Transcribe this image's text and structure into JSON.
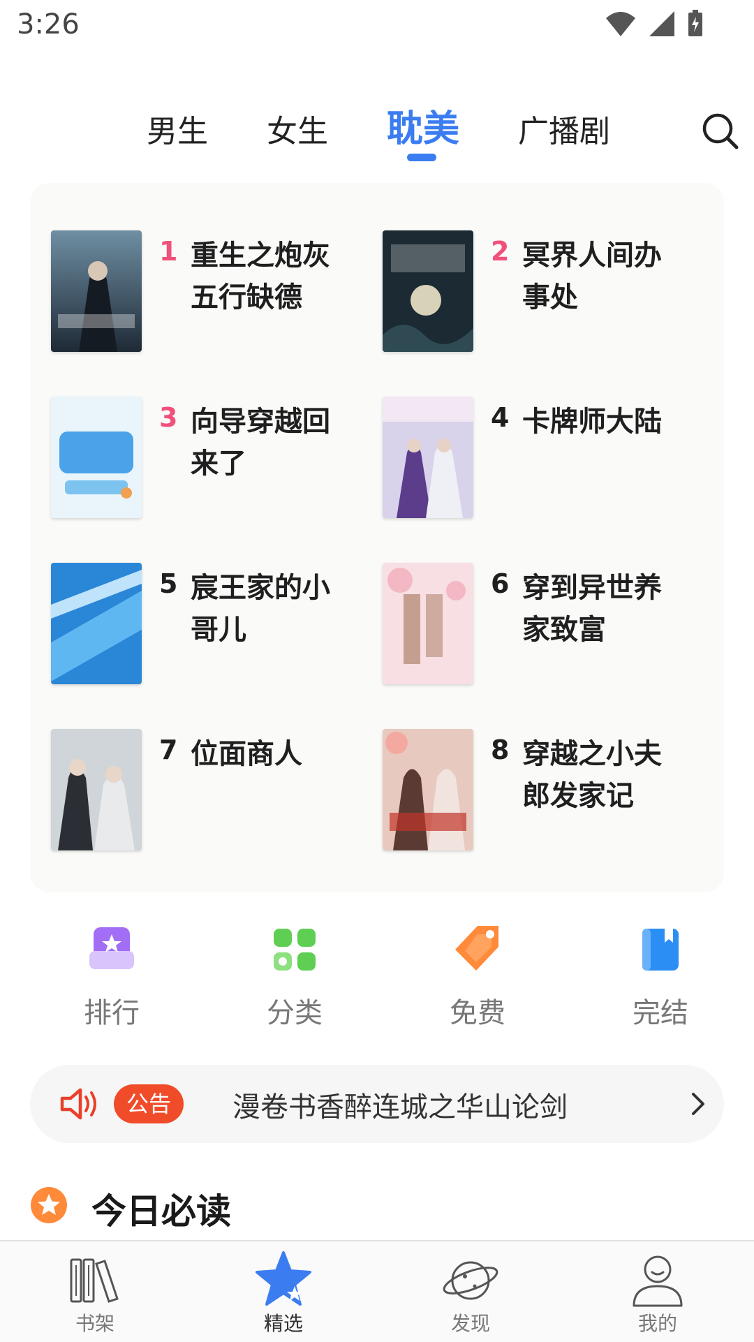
{
  "status_bar": {
    "time": "3:26"
  },
  "top_tabs": [
    {
      "label": "男生"
    },
    {
      "label": "女生"
    },
    {
      "label": "耽美",
      "active": true
    },
    {
      "label": "广播剧"
    }
  ],
  "ranking": [
    {
      "rank": "1",
      "title": "重生之炮灰五行缺德"
    },
    {
      "rank": "2",
      "title": "冥界人间办事处"
    },
    {
      "rank": "3",
      "title": "向导穿越回来了"
    },
    {
      "rank": "4",
      "title": "卡牌师大陆"
    },
    {
      "rank": "5",
      "title": "宸王家的小哥儿"
    },
    {
      "rank": "6",
      "title": "穿到异世养家致富"
    },
    {
      "rank": "7",
      "title": "位面商人"
    },
    {
      "rank": "8",
      "title": "穿越之小夫郎发家记"
    }
  ],
  "quick_nav": [
    {
      "label": "排行",
      "icon": "ranking-icon"
    },
    {
      "label": "分类",
      "icon": "category-icon"
    },
    {
      "label": "免费",
      "icon": "free-tag-icon"
    },
    {
      "label": "完结",
      "icon": "finished-book-icon"
    }
  ],
  "notice": {
    "badge": "公告",
    "text": "漫卷书香醉连城之华山论剑"
  },
  "section": {
    "title": "今日必读"
  },
  "bottom_nav": [
    {
      "label": "书架",
      "icon": "bookshelf-icon"
    },
    {
      "label": "精选",
      "icon": "featured-star-icon",
      "active": true
    },
    {
      "label": "发现",
      "icon": "planet-icon"
    },
    {
      "label": "我的",
      "icon": "profile-icon"
    }
  ],
  "colors": {
    "accent": "#3b7df1",
    "hot_rank": "#f0507a",
    "notice_badge": "#f04c2a"
  }
}
